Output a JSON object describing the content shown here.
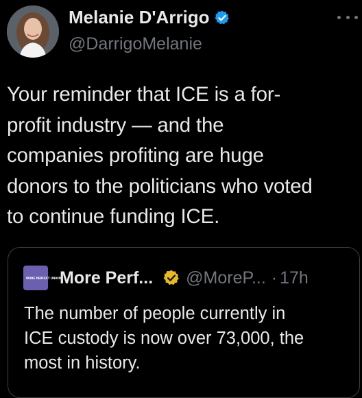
{
  "author": {
    "name": "Melanie D'Arrigo",
    "handle": "@DarrigoMelanie",
    "verified": true
  },
  "tweet": {
    "text": "Your reminder that ICE is a for-\nprofit industry — and the\ncompanies profiting are huge\ndonors to the politicians who voted\nto continue funding ICE."
  },
  "quote": {
    "avatar_text": "MORE PERFECT UNION",
    "name": "More Perf...",
    "handle": "@MoreP...",
    "separator": "·",
    "time": "17h",
    "text": "The number of people currently in\nICE custody is now over 73,000, the\nmost in history."
  },
  "colors": {
    "background": "#000000",
    "primary_text": "#e7e9ea",
    "secondary_text": "#71767b",
    "verified_blue": "#1d9bf0",
    "verified_gold": "#e8b829",
    "quote_border": "#3e4144",
    "quote_avatar": "#6b5fb0"
  },
  "icons": {
    "verified": "verified-badge-icon",
    "gold_verified": "gold-verified-badge-icon",
    "more": "more-options-icon"
  }
}
